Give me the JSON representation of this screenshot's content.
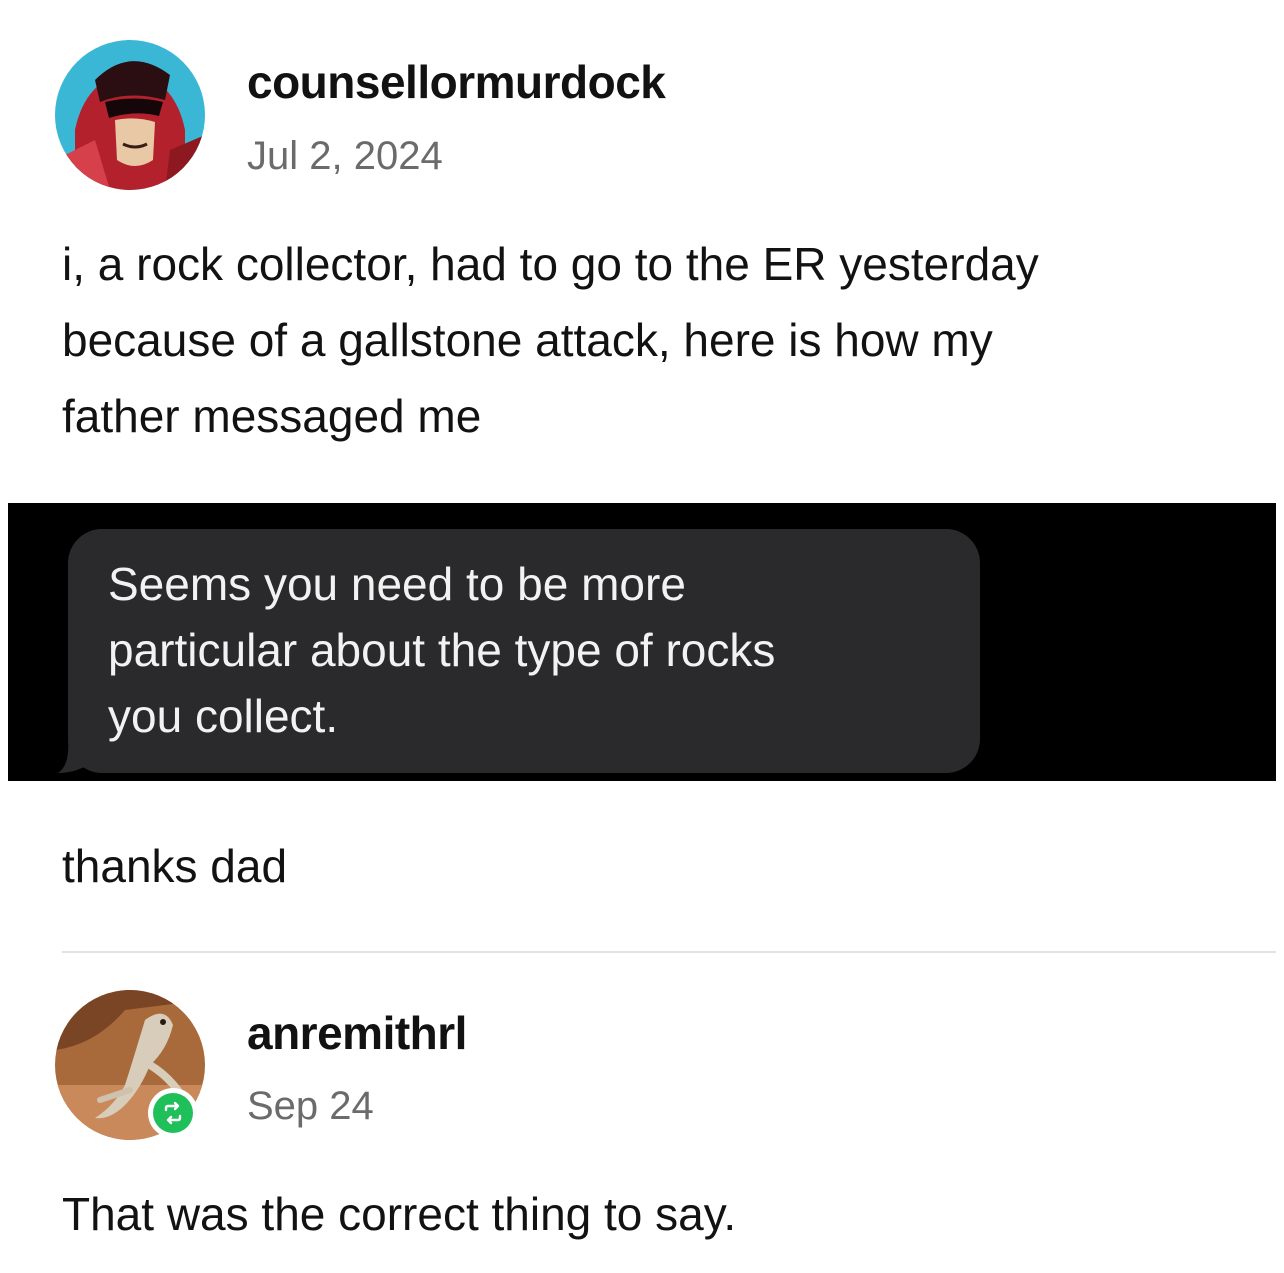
{
  "post": {
    "author": "counsellormurdock",
    "date": "Jul 2, 2024",
    "text_lines": [
      "i, a rock collector, had to go to the ER yesterday",
      "because of a gallstone attack, here is how my",
      "father messaged me"
    ],
    "message_lines": [
      "Seems you need to be more",
      "particular about the type of rocks",
      "you collect."
    ],
    "after_text": "thanks dad"
  },
  "reply": {
    "author": "anremithrl",
    "date": "Sep 24",
    "text": "That was the correct thing to say."
  },
  "colors": {
    "bubble": "#2a2a2c",
    "reblog_badge": "#1fbf5a"
  }
}
